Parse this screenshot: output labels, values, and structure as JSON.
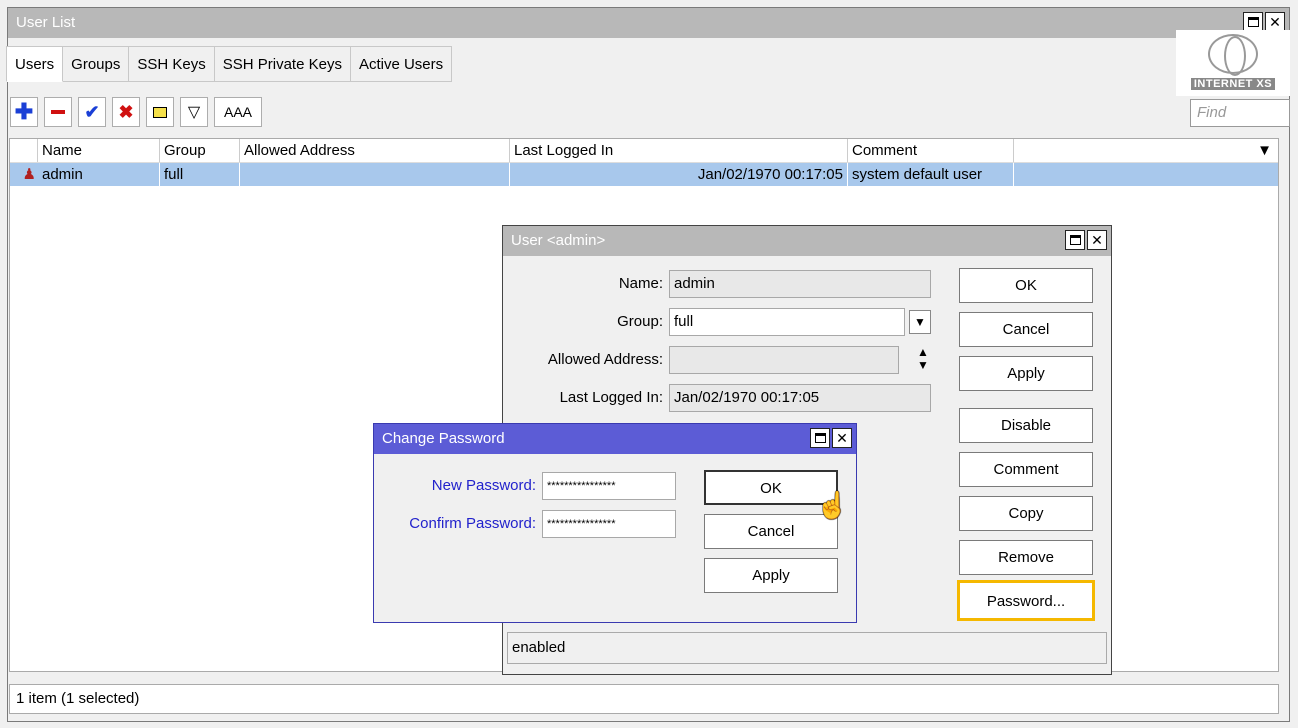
{
  "window": {
    "title": "User List"
  },
  "tabs": [
    "Users",
    "Groups",
    "SSH Keys",
    "SSH Private Keys",
    "Active Users"
  ],
  "toolbar": {
    "aaa_label": "AAA"
  },
  "logo": {
    "brand": "INTERNET XS"
  },
  "find": {
    "placeholder": "Find"
  },
  "table": {
    "columns": [
      "Name",
      "Group",
      "Allowed Address",
      "Last Logged In",
      "Comment"
    ],
    "rows": [
      {
        "name": "admin",
        "group": "full",
        "allowed_address": "",
        "last_logged_in": "Jan/02/1970 00:17:05",
        "comment": "system default user"
      }
    ]
  },
  "status_bar": "1 item (1 selected)",
  "user_dialog": {
    "title": "User <admin>",
    "name_label": "Name:",
    "name_value": "admin",
    "group_label": "Group:",
    "group_value": "full",
    "allowed_label": "Allowed Address:",
    "allowed_value": "",
    "last_label": "Last Logged In:",
    "last_value": "Jan/02/1970 00:17:05",
    "buttons": [
      "OK",
      "Cancel",
      "Apply",
      "Disable",
      "Comment",
      "Copy",
      "Remove",
      "Password..."
    ],
    "status": "enabled"
  },
  "password_dialog": {
    "title": "Change Password",
    "new_label": "New Password:",
    "new_value": "****************",
    "confirm_label": "Confirm Password:",
    "confirm_value": "****************",
    "buttons": [
      "OK",
      "Cancel",
      "Apply"
    ]
  },
  "colors": {
    "password_title_bar": "#5c5cd6",
    "highlight_border": "#f5b800",
    "selected_row": "#a8c8ec",
    "label_blue": "#2222cc"
  }
}
